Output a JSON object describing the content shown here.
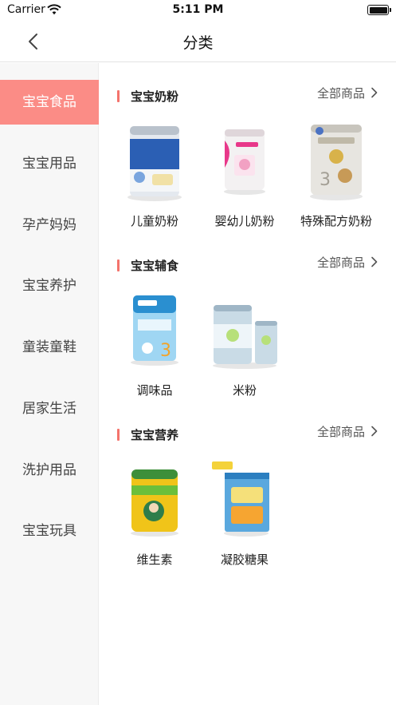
{
  "status": {
    "carrier": "Carrier",
    "time": "5:11 PM"
  },
  "nav": {
    "title": "分类"
  },
  "sidebar": {
    "items": [
      {
        "label": "宝宝食品"
      },
      {
        "label": "宝宝用品"
      },
      {
        "label": "孕产妈妈"
      },
      {
        "label": "宝宝养护"
      },
      {
        "label": "童装童鞋"
      },
      {
        "label": "居家生活"
      },
      {
        "label": "洗护用品"
      },
      {
        "label": "宝宝玩具"
      }
    ]
  },
  "sections": [
    {
      "title": "宝宝奶粉",
      "all_label": "全部商品",
      "products": [
        {
          "label": "儿童奶粉",
          "icon": "milk-can-blue-icon"
        },
        {
          "label": "婴幼儿奶粉",
          "icon": "milk-can-pink-icon"
        },
        {
          "label": "特殊配方奶粉",
          "icon": "milk-can-platinum-icon"
        }
      ]
    },
    {
      "title": "宝宝辅食",
      "all_label": "全部商品",
      "products": [
        {
          "label": "调味品",
          "icon": "aptamil-box-icon"
        },
        {
          "label": "米粉",
          "icon": "rice-cereal-cans-icon"
        }
      ]
    },
    {
      "title": "宝宝营养",
      "all_label": "全部商品",
      "products": [
        {
          "label": "维生素",
          "icon": "vitamin-jar-icon"
        },
        {
          "label": "凝胶糖果",
          "icon": "gummy-box-icon"
        }
      ]
    }
  ],
  "colors": {
    "accent": "#fb8c86",
    "section_bar": "#f4736c",
    "sidebar_bg": "#f7f7f7"
  }
}
